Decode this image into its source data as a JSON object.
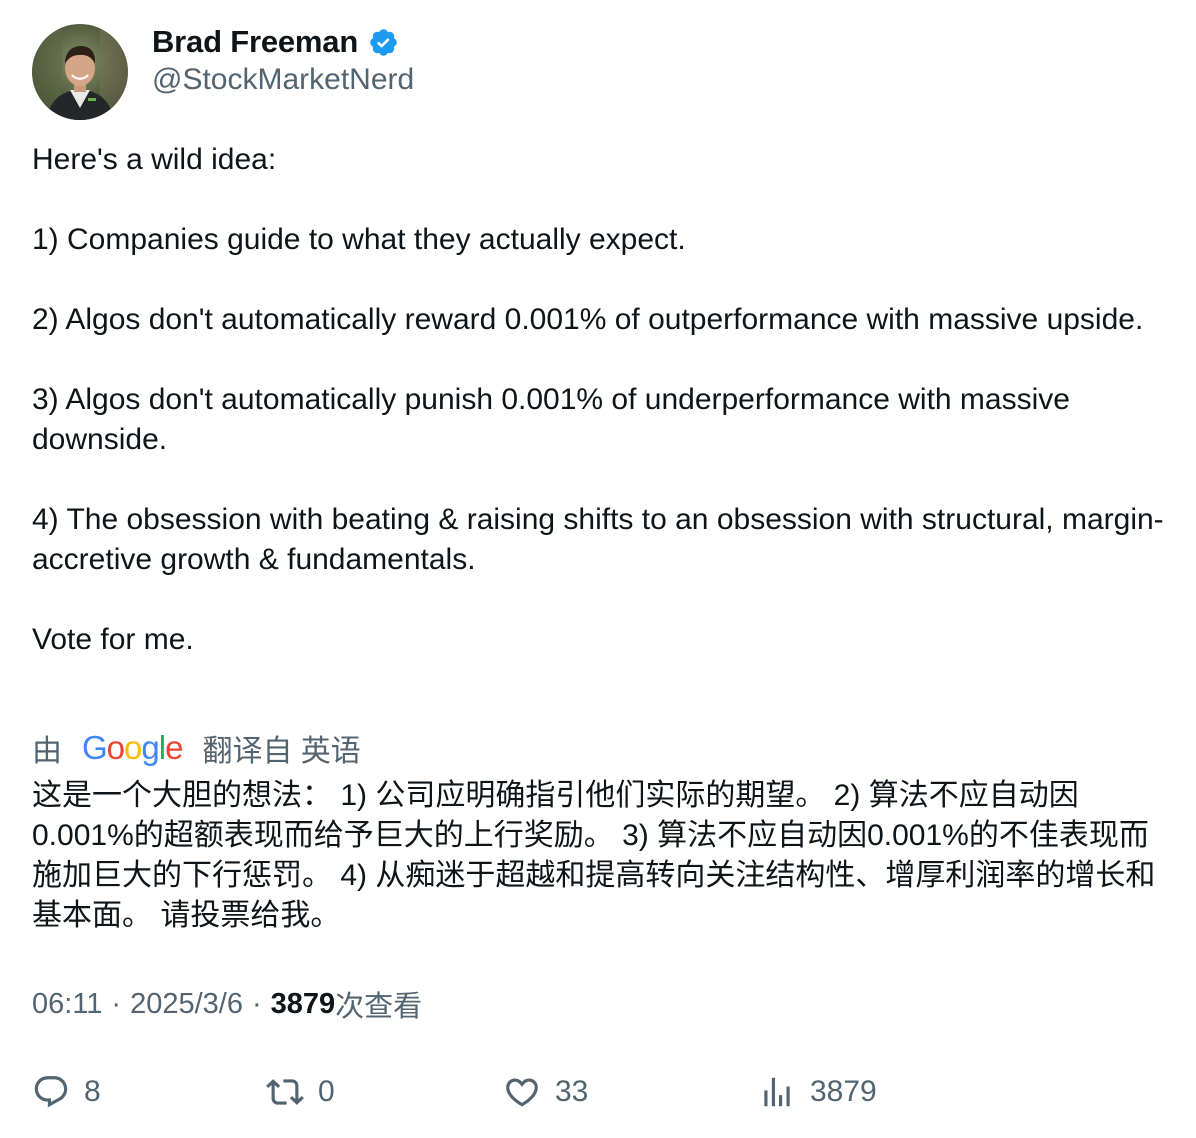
{
  "author": {
    "name": "Brad Freeman",
    "handle": "@StockMarketNerd",
    "verified": true,
    "verified_color": "#1d9bf0"
  },
  "tweet": {
    "paragraphs": [
      "Here's a wild idea:",
      "1) Companies guide to what they actually expect.",
      "2) Algos don't automatically reward 0.001% of outperformance with massive upside.",
      "3) Algos don't automatically punish 0.001% of underperformance with massive downside.",
      "4) The obsession with beating & raising shifts to an obsession with structural, margin-accretive growth & fundamentals.",
      "Vote for me."
    ]
  },
  "translation": {
    "prefix": "由",
    "provider": "Google",
    "suffix": "翻译自 英语",
    "text": "这是一个大胆的想法： 1) 公司应明确指引他们实际的期望。 2) 算法不应自动因0.001%的超额表现而给予巨大的上行奖励。 3) 算法不应自动因0.001%的不佳表现而施加巨大的下行惩罚。 4) 从痴迷于超越和提高转向关注结构性、增厚利润率的增长和基本面。 请投票给我。"
  },
  "meta": {
    "time": "06:11",
    "separator": "·",
    "date": "2025/3/6",
    "views_count": "3879",
    "views_label": "次查看"
  },
  "actions": {
    "replies": "8",
    "retweets": "0",
    "likes": "33",
    "views": "3879"
  },
  "colors": {
    "text_primary": "#0f1419",
    "text_secondary": "#536471",
    "accent": "#1d9bf0"
  },
  "icons": {
    "reply": "reply-icon",
    "retweet": "retweet-icon",
    "like": "heart-icon",
    "views": "views-chart-icon",
    "verified": "verified-badge-icon"
  }
}
